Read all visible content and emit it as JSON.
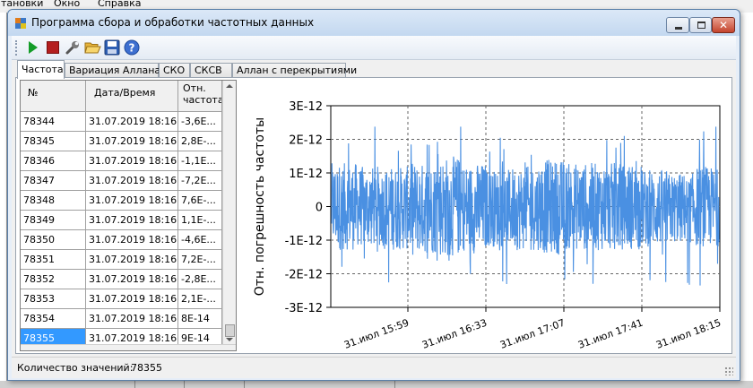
{
  "background_app": {
    "menu": [
      "тановки",
      "Окно",
      "Справка"
    ]
  },
  "window": {
    "title": "Программа сбора и обработки частотных данных",
    "buttons": {
      "minimize": "minimize",
      "maximize": "maximize",
      "close": "✕"
    }
  },
  "toolbar": {
    "items": [
      {
        "name": "start",
        "icon": "play-icon",
        "color": "#149c28"
      },
      {
        "name": "stop",
        "icon": "stop-icon",
        "color": "#b41e1e"
      },
      {
        "name": "settings",
        "icon": "wrench-icon"
      },
      {
        "name": "open",
        "icon": "folder-open-icon"
      },
      {
        "name": "save",
        "icon": "floppy-disk-icon"
      },
      {
        "name": "help",
        "icon": "help-icon"
      }
    ]
  },
  "tabs": [
    "Частота",
    "Вариация Аллана",
    "СКО",
    "СКСВ",
    "Аллан с перекрытиями"
  ],
  "active_tab": "Частота",
  "table": {
    "headers": [
      "№",
      "Дата/Время",
      "Отн. частота"
    ],
    "rows": [
      [
        "78344",
        "31.07.2019 18:16...",
        "-3,6E..."
      ],
      [
        "78345",
        "31.07.2019 18:16...",
        "2,8E-..."
      ],
      [
        "78346",
        "31.07.2019 18:16...",
        "-1,1E..."
      ],
      [
        "78347",
        "31.07.2019 18:16...",
        "-7,2E..."
      ],
      [
        "78348",
        "31.07.2019 18:16...",
        "7,6E-..."
      ],
      [
        "78349",
        "31.07.2019 18:16...",
        "1,1E-..."
      ],
      [
        "78350",
        "31.07.2019 18:16...",
        "-4,6E..."
      ],
      [
        "78351",
        "31.07.2019 18:16...",
        "7,2E-..."
      ],
      [
        "78352",
        "31.07.2019 18:16...",
        "-2,8E..."
      ],
      [
        "78353",
        "31.07.2019 18:16...",
        "2,1E-..."
      ],
      [
        "78354",
        "31.07.2019 18:16...",
        "8E-14"
      ],
      [
        "78355",
        "31.07.2019 18:16...",
        "9E-14"
      ]
    ],
    "selected_row": 11
  },
  "chart_data": {
    "type": "line",
    "ylabel": "Отн. погрешность частоты",
    "yticks": [
      "3E-12",
      "2E-12",
      "1E-12",
      "0",
      "-1E-12",
      "-2E-12",
      "-3E-12"
    ],
    "ylim": [
      -3e-12,
      3e-12
    ],
    "xticks": [
      "31.июл 15:59",
      "31.июл 16:33",
      "31.июл 17:07",
      "31.июл 17:41",
      "31.июл 18:15"
    ],
    "x_range": [
      "31.июл 15:25",
      "31.июл 18:15"
    ],
    "grid": true,
    "line_color": "#4a90e2",
    "series": [
      {
        "band_upper": [
          1.3e-12,
          1.2e-12,
          1.2e-12,
          1.3e-12,
          1.5e-12,
          1.3e-12,
          1.1e-12,
          1.2e-12,
          1.4e-12,
          1.3e-12,
          1.3e-12,
          1.3e-12,
          1.1e-12,
          1e-12,
          1.2e-12
        ],
        "band_lower": [
          -1.3e-12,
          -1.2e-12,
          -1.3e-12,
          -1.4e-12,
          -1.5e-12,
          -1.4e-12,
          -1.2e-12,
          -1.3e-12,
          -1.4e-12,
          -1.3e-12,
          -1.3e-12,
          -1.3e-12,
          -1.2e-12,
          -1.1e-12,
          -1.2e-12
        ],
        "peak_max": 2.4e-12,
        "peak_min": -2.4e-12
      }
    ]
  },
  "status": {
    "count_label": "Количество значений:",
    "count_value": "78355"
  }
}
